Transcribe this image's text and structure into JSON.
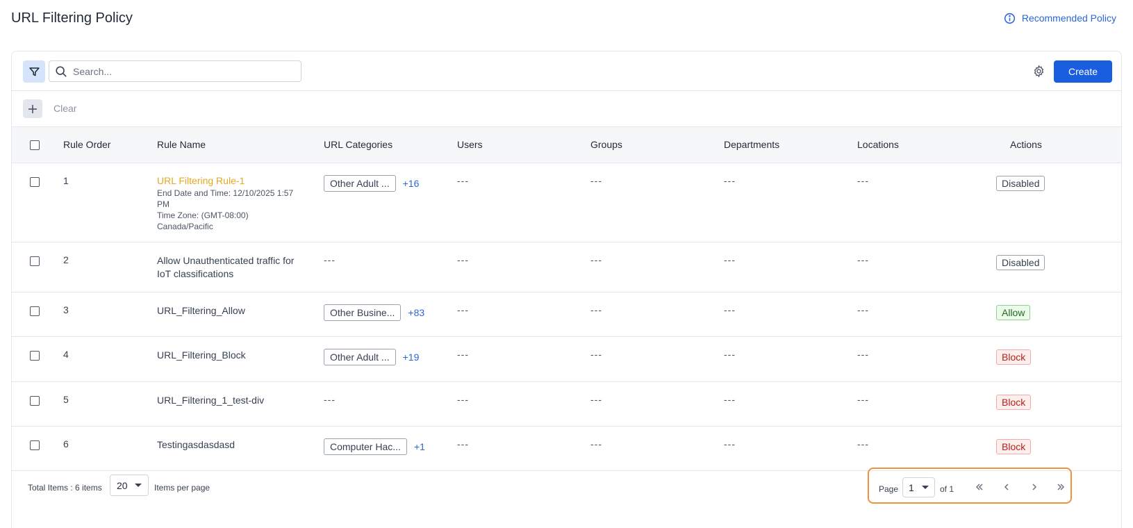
{
  "header": {
    "title": "URL Filtering Policy",
    "recommended_label": "Recommended Policy"
  },
  "toolbar": {
    "search_placeholder": "Search...",
    "create_label": "Create"
  },
  "filterbar": {
    "clear_label": "Clear"
  },
  "table": {
    "columns": [
      "Rule Order",
      "Rule Name",
      "URL Categories",
      "Users",
      "Groups",
      "Departments",
      "Locations",
      "Actions"
    ],
    "rows": [
      {
        "order": "1",
        "name": "URL Filtering Rule-1",
        "name_highlight": true,
        "sub_lines": [
          "End Date and Time: 12/10/2025 1:57 PM",
          "Time Zone: (GMT-08:00) Canada/Pacific"
        ],
        "category": "Other Adult ...",
        "more": "+16",
        "users": "---",
        "groups": "---",
        "departments": "---",
        "locations": "---",
        "action": "Disabled",
        "action_type": "disabled"
      },
      {
        "order": "2",
        "name": "Allow Unauthenticated traffic for IoT classifications",
        "name_highlight": false,
        "sub_lines": [],
        "category": "",
        "category_empty": "---",
        "more": "",
        "users": "---",
        "groups": "---",
        "departments": "---",
        "locations": "---",
        "action": "Disabled",
        "action_type": "disabled"
      },
      {
        "order": "3",
        "name": "URL_Filtering_Allow",
        "name_highlight": false,
        "sub_lines": [],
        "category": "Other Busine...",
        "more": "+83",
        "users": "---",
        "groups": "---",
        "departments": "---",
        "locations": "---",
        "action": "Allow",
        "action_type": "allow"
      },
      {
        "order": "4",
        "name": "URL_Filtering_Block",
        "name_highlight": false,
        "sub_lines": [],
        "category": "Other Adult ...",
        "more": "+19",
        "users": "---",
        "groups": "---",
        "departments": "---",
        "locations": "---",
        "action": "Block",
        "action_type": "block"
      },
      {
        "order": "5",
        "name": "URL_Filtering_1_test-div",
        "name_highlight": false,
        "sub_lines": [],
        "category": "",
        "category_empty": "---",
        "more": "",
        "users": "---",
        "groups": "---",
        "departments": "---",
        "locations": "---",
        "action": "Block",
        "action_type": "block"
      },
      {
        "order": "6",
        "name": "Testingasdasdasd",
        "name_highlight": false,
        "sub_lines": [],
        "category": "Computer Hac...",
        "more": "+1",
        "users": "---",
        "groups": "---",
        "departments": "---",
        "locations": "---",
        "action": "Block",
        "action_type": "block"
      }
    ]
  },
  "footer": {
    "total_label": "Total Items : 6 items",
    "per_page_value": "20",
    "per_page_label": "Items per page",
    "page_label": "Page",
    "page_value": "1",
    "of_label": "of 1"
  },
  "colors": {
    "primary": "#1a5ee0",
    "link": "#2a66d9",
    "highlight_name": "#e6a820",
    "pager_outline": "#f0913e"
  }
}
